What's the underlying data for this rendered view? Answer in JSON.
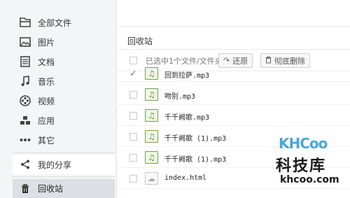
{
  "sidebar": {
    "items": [
      {
        "label": "全部文件",
        "icon": "folder-icon"
      },
      {
        "label": "图片",
        "icon": "image-icon"
      },
      {
        "label": "文档",
        "icon": "document-icon"
      },
      {
        "label": "音乐",
        "icon": "music-icon"
      },
      {
        "label": "视频",
        "icon": "video-icon"
      },
      {
        "label": "应用",
        "icon": "apps-icon"
      },
      {
        "label": "其它",
        "icon": "more-icon"
      }
    ],
    "share": {
      "label": "我的分享",
      "icon": "share-icon"
    },
    "recycle": {
      "label": "回收站",
      "icon": "trash-icon"
    }
  },
  "main": {
    "title": "回收站",
    "toolbar": {
      "selection_text": "已选中1个文件/文件夹",
      "restore_label": "还原",
      "delete_label": "彻底删除"
    },
    "files": [
      {
        "name": "回到拉萨.mp3",
        "type": "music",
        "checked": true
      },
      {
        "name": "吻别.mp3",
        "type": "music",
        "checked": false
      },
      {
        "name": "千千阙歌.mp3",
        "type": "music",
        "checked": false
      },
      {
        "name": "千千阙歌 (1).mp3",
        "type": "music",
        "checked": false
      },
      {
        "name": "千千阙歌 (1).mp3",
        "type": "music",
        "checked": false
      },
      {
        "name": "index.html",
        "type": "html",
        "checked": false
      }
    ]
  },
  "watermark": {
    "brand": "KHCoo",
    "chinese": "科技库",
    "url": "khcoo.com"
  },
  "colors": {
    "sidebar_bg": "#f4f5f7",
    "active_bg": "#dcdfe3",
    "music_icon": "#7aa04a",
    "watermark_blue": "#4aa7d8"
  }
}
